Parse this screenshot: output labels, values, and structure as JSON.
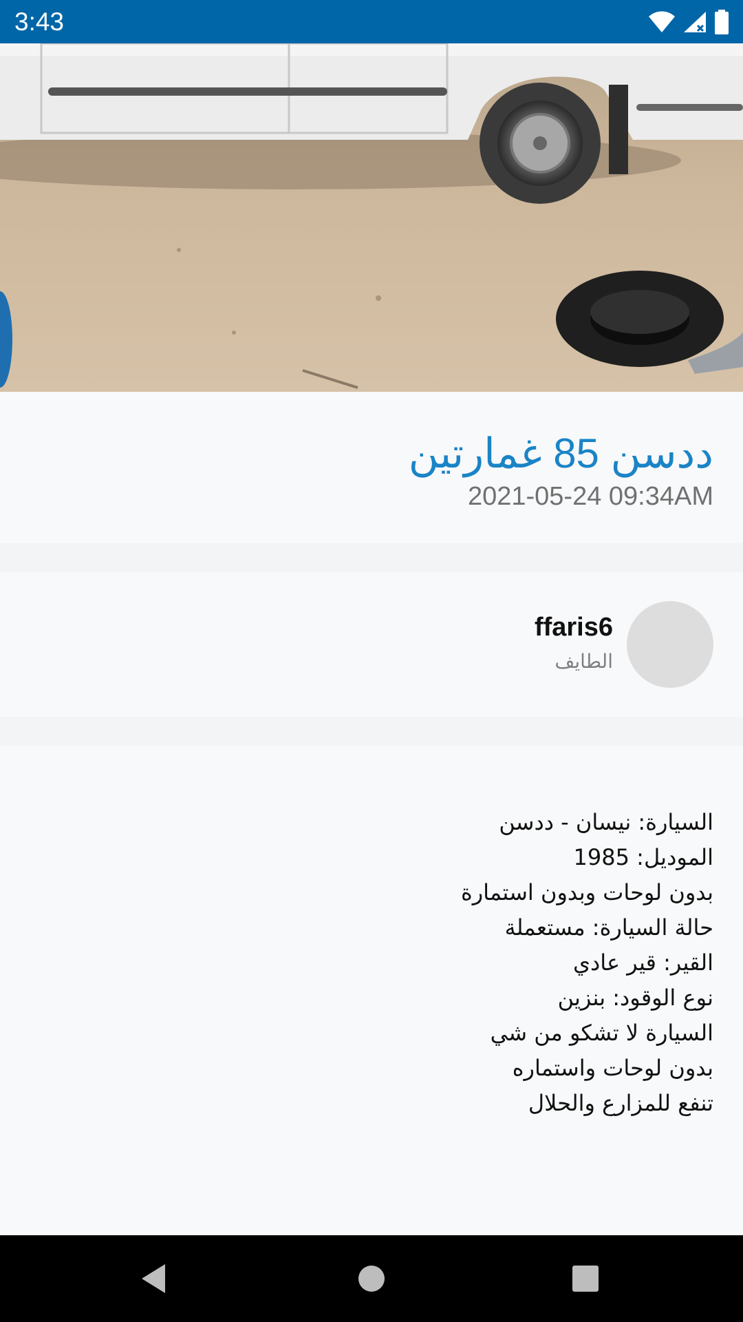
{
  "status_bar": {
    "time": "3:43",
    "icons": [
      "wifi-icon",
      "cell-signal-icon",
      "battery-icon"
    ]
  },
  "listing": {
    "photo": "pickup-truck-photo",
    "title": "ددسن 85 غمارتين",
    "date": "2021-05-24 09:34AM"
  },
  "seller": {
    "username": "ffaris6",
    "city": "الطايف"
  },
  "description": {
    "lines": [
      "السيارة: نيسان - ددسن",
      "الموديل: 1985",
      "بدون لوحات وبدون استمارة",
      "حالة السيارة: مستعملة",
      "القير: قير عادي",
      "نوع الوقود: بنزين",
      "السيارة لا تشكو من شي",
      "بدون لوحات واستماره",
      "تنفع للمزارع والحلال"
    ]
  },
  "nav": {
    "buttons": [
      "back-icon",
      "home-icon",
      "recents-icon"
    ]
  },
  "colors": {
    "status_bar": "#0066a8",
    "title": "#1a84c6",
    "background": "#f8f9fa"
  }
}
